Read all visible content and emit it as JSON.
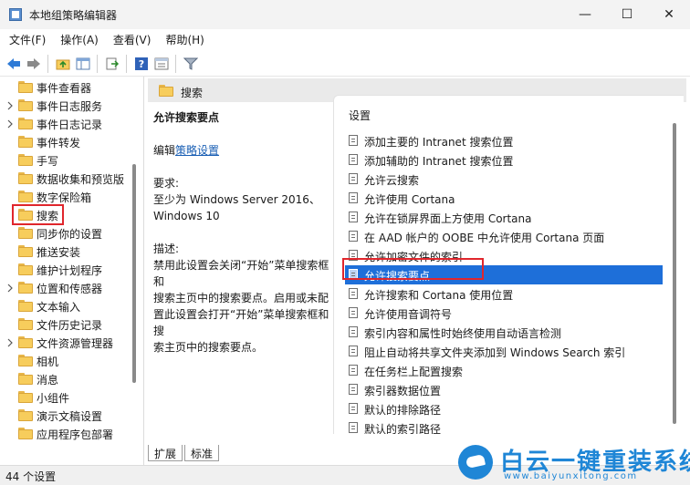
{
  "window": {
    "title": "本地组策略编辑器",
    "minimize": "—",
    "maximize": "☐",
    "close": "✕"
  },
  "menu": [
    "文件(F)",
    "操作(A)",
    "查看(V)",
    "帮助(H)"
  ],
  "toolbar": {
    "icons": [
      "back-icon",
      "forward-icon",
      "up-folder-icon",
      "show-hide-tree-icon",
      "export-list-icon",
      "help-icon",
      "properties-icon",
      "filter-icon"
    ]
  },
  "tree": {
    "items": [
      {
        "label": "事件查看器",
        "expandable": false
      },
      {
        "label": "事件日志服务",
        "expandable": true
      },
      {
        "label": "事件日志记录",
        "expandable": true
      },
      {
        "label": "事件转发",
        "expandable": false
      },
      {
        "label": "手写",
        "expandable": false
      },
      {
        "label": "数据收集和预览版",
        "expandable": false
      },
      {
        "label": "数字保险箱",
        "expandable": false
      },
      {
        "label": "搜索",
        "expandable": false,
        "selected": true
      },
      {
        "label": "同步你的设置",
        "expandable": false
      },
      {
        "label": "推送安装",
        "expandable": false
      },
      {
        "label": "维护计划程序",
        "expandable": false
      },
      {
        "label": "位置和传感器",
        "expandable": true
      },
      {
        "label": "文本输入",
        "expandable": false
      },
      {
        "label": "文件历史记录",
        "expandable": false
      },
      {
        "label": "文件资源管理器",
        "expandable": true
      },
      {
        "label": "相机",
        "expandable": false
      },
      {
        "label": "消息",
        "expandable": false
      },
      {
        "label": "小组件",
        "expandable": false
      },
      {
        "label": "演示文稿设置",
        "expandable": false
      },
      {
        "label": "应用程序包部署",
        "expandable": false
      }
    ]
  },
  "content": {
    "header": "搜索",
    "description": {
      "title": "允许搜索要点",
      "edit_prefix": "编辑",
      "edit_link": "策略设置",
      "req_label": "要求:",
      "req_line1": "至少为 Windows Server 2016、",
      "req_line2": "Windows 10",
      "desc_label": "描述:",
      "desc_lines": [
        "禁用此设置会关闭“开始”菜单搜索框和",
        "搜索主页中的搜索要点。启用或未配",
        "置此设置会打开“开始”菜单搜索框和搜",
        "索主页中的搜索要点。"
      ]
    },
    "settings_header": "设置",
    "settings": [
      "添加主要的 Intranet 搜索位置",
      "添加辅助的 Intranet 搜索位置",
      "允许云搜索",
      "允许使用 Cortana",
      "允许在锁屏界面上方使用 Cortana",
      "在 AAD 帐户的 OOBE 中允许使用 Cortana 页面",
      "允许加密文件的索引",
      "允许搜索要点",
      "允许搜索和 Cortana 使用位置",
      "允许使用音调符号",
      "索引内容和属性时始终使用自动语言检测",
      "阻止自动将共享文件夹添加到 Windows Search 索引",
      "在任务栏上配置搜索",
      "索引器数据位置",
      "默认的排除路径",
      "默认的索引路径"
    ],
    "selected_index": 7,
    "tabs": [
      "扩展",
      "标准"
    ]
  },
  "status": {
    "text": "44 个设置"
  },
  "watermark": {
    "title": "白云一键重装系统",
    "url": "www.baiyunxitong.com"
  },
  "colors": {
    "selection": "#1e6fd9",
    "highlight": "#e0262c",
    "link": "#1a5fb4",
    "brand": "#1f86d6"
  }
}
